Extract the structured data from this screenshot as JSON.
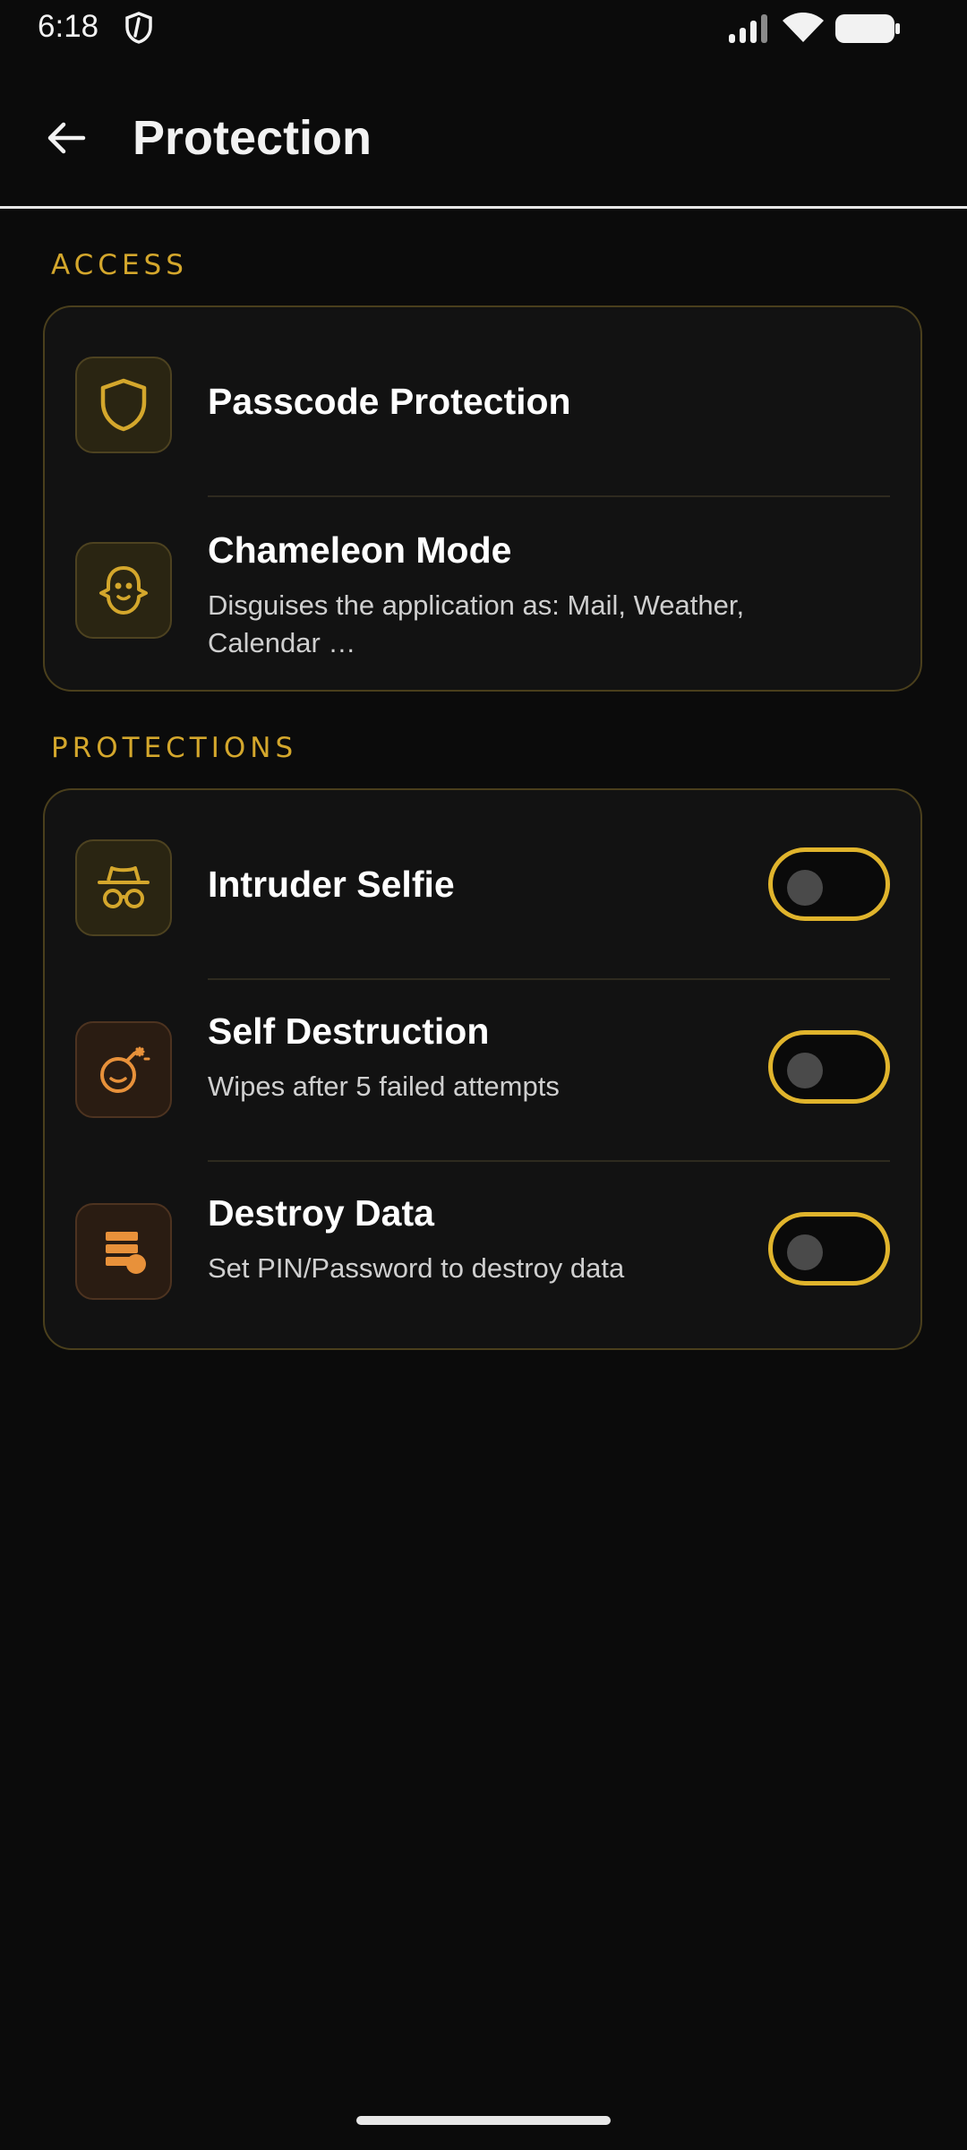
{
  "status_bar": {
    "time": "6:18"
  },
  "header": {
    "title": "Protection",
    "back_icon": "arrow-left-icon"
  },
  "sections": {
    "access": {
      "header": "ACCESS",
      "items": [
        {
          "title": "Passcode Protection",
          "description": "",
          "icon": "shield-icon"
        },
        {
          "title": "Chameleon Mode",
          "description": "Disguises the application as: Mail, Weather, Calendar …",
          "icon": "ghost-icon"
        }
      ]
    },
    "protections": {
      "header": "PROTECTIONS",
      "items": [
        {
          "title": "Intruder Selfie",
          "description": "",
          "icon": "spy-icon",
          "toggle_on": false
        },
        {
          "title": "Self Destruction",
          "description": "Wipes after 5 failed attempts",
          "icon": "bomb-icon",
          "toggle_on": false
        },
        {
          "title": "Destroy Data",
          "description": "Set PIN/Password to destroy data",
          "icon": "data-destroy-icon",
          "toggle_on": false
        }
      ]
    }
  },
  "colors": {
    "background": "#0b0b0b",
    "accent_gold": "#d4a72c",
    "accent_orange": "#e8913a",
    "card_border": "#4a3f1c"
  }
}
